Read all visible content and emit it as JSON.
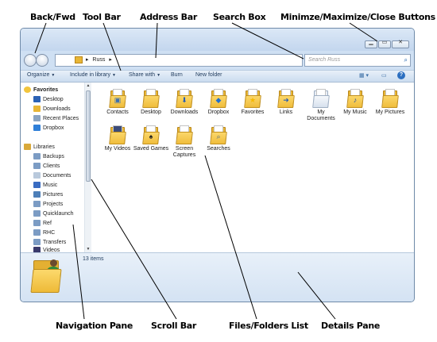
{
  "callouts": {
    "back_fwd": "Back/Fwd",
    "tool_bar": "Tool Bar",
    "address_bar": "Address Bar",
    "search_box": "Search Box",
    "window_buttons": "Minimze/Maximize/Close Buttons",
    "navigation_pane": "Navigation Pane",
    "scroll_bar": "Scroll Bar",
    "files_folders_list": "Files/Folders List",
    "details_pane": "Details Pane"
  },
  "address": {
    "path": "Russ",
    "separator": "▸"
  },
  "search": {
    "placeholder": "Search Russ"
  },
  "toolbar": {
    "organize": "Organize",
    "include": "Include in library",
    "share": "Share with",
    "burn": "Burn",
    "new_folder": "New folder"
  },
  "nav": {
    "favorites_header": "Favorites",
    "favorites": [
      "Desktop",
      "Downloads",
      "Recent Places",
      "Dropbox"
    ],
    "libraries_header": "Libraries",
    "libraries": [
      "Backups",
      "Clients",
      "Documents",
      "Music",
      "Pictures",
      "Projects",
      "Quicklaunch",
      "Ref",
      "RHC",
      "Transfers",
      "Videos"
    ]
  },
  "files": [
    "Contacts",
    "Desktop",
    "Downloads",
    "Dropbox",
    "Favorites",
    "Links",
    "My Documents",
    "My Music",
    "My Pictures",
    "My Videos",
    "Saved Games",
    "Screen Captures",
    "Searches"
  ],
  "details": {
    "count": "13 items"
  },
  "colors": {
    "folder": "#f0bd3c",
    "chrome": "#cfe0f3",
    "toolbar_text": "#1e395b"
  }
}
